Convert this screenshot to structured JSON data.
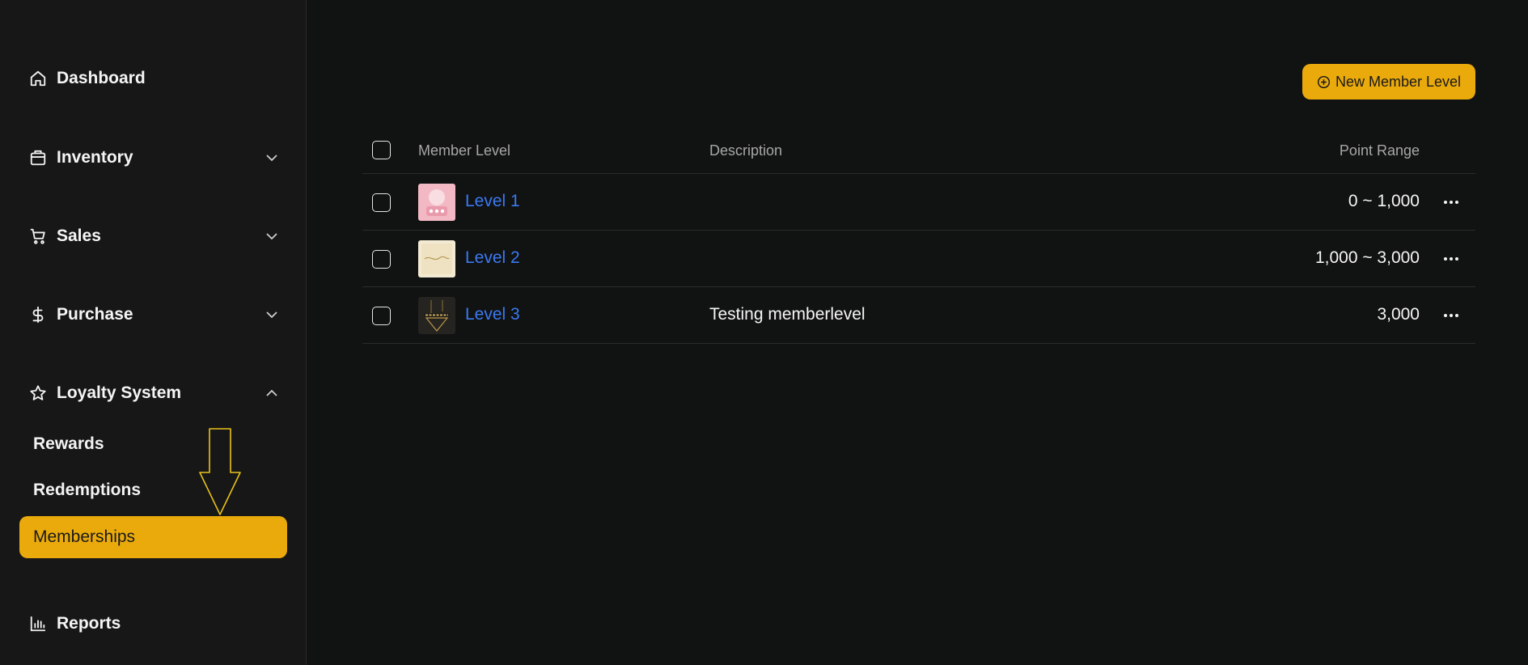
{
  "sidebar": {
    "items": [
      {
        "label": "Dashboard",
        "icon": "home-icon"
      },
      {
        "label": "Inventory",
        "icon": "box-icon"
      },
      {
        "label": "Sales",
        "icon": "cart-icon"
      },
      {
        "label": "Purchase",
        "icon": "dollar-icon"
      },
      {
        "label": "Loyalty System",
        "icon": "star-icon"
      },
      {
        "label": "Reports",
        "icon": "bar-chart-icon"
      }
    ],
    "loyalty_subitems": [
      {
        "label": "Rewards"
      },
      {
        "label": "Redemptions"
      },
      {
        "label": "Memberships",
        "active": true
      }
    ]
  },
  "toolbar": {
    "new_label": "New Member Level"
  },
  "table": {
    "columns": {
      "level": "Member Level",
      "description": "Description",
      "range": "Point Range"
    },
    "rows": [
      {
        "level": "Level 1",
        "description": "",
        "range": "0 ~ 1,000"
      },
      {
        "level": "Level 2",
        "description": "",
        "range": "1,000 ~ 3,000"
      },
      {
        "level": "Level 3",
        "description": "Testing memberlevel",
        "range": "3,000"
      }
    ]
  },
  "colors": {
    "accent": "#eaaa0c",
    "link": "#3a7af2",
    "background": "#111212",
    "sidebar": "#171717"
  }
}
